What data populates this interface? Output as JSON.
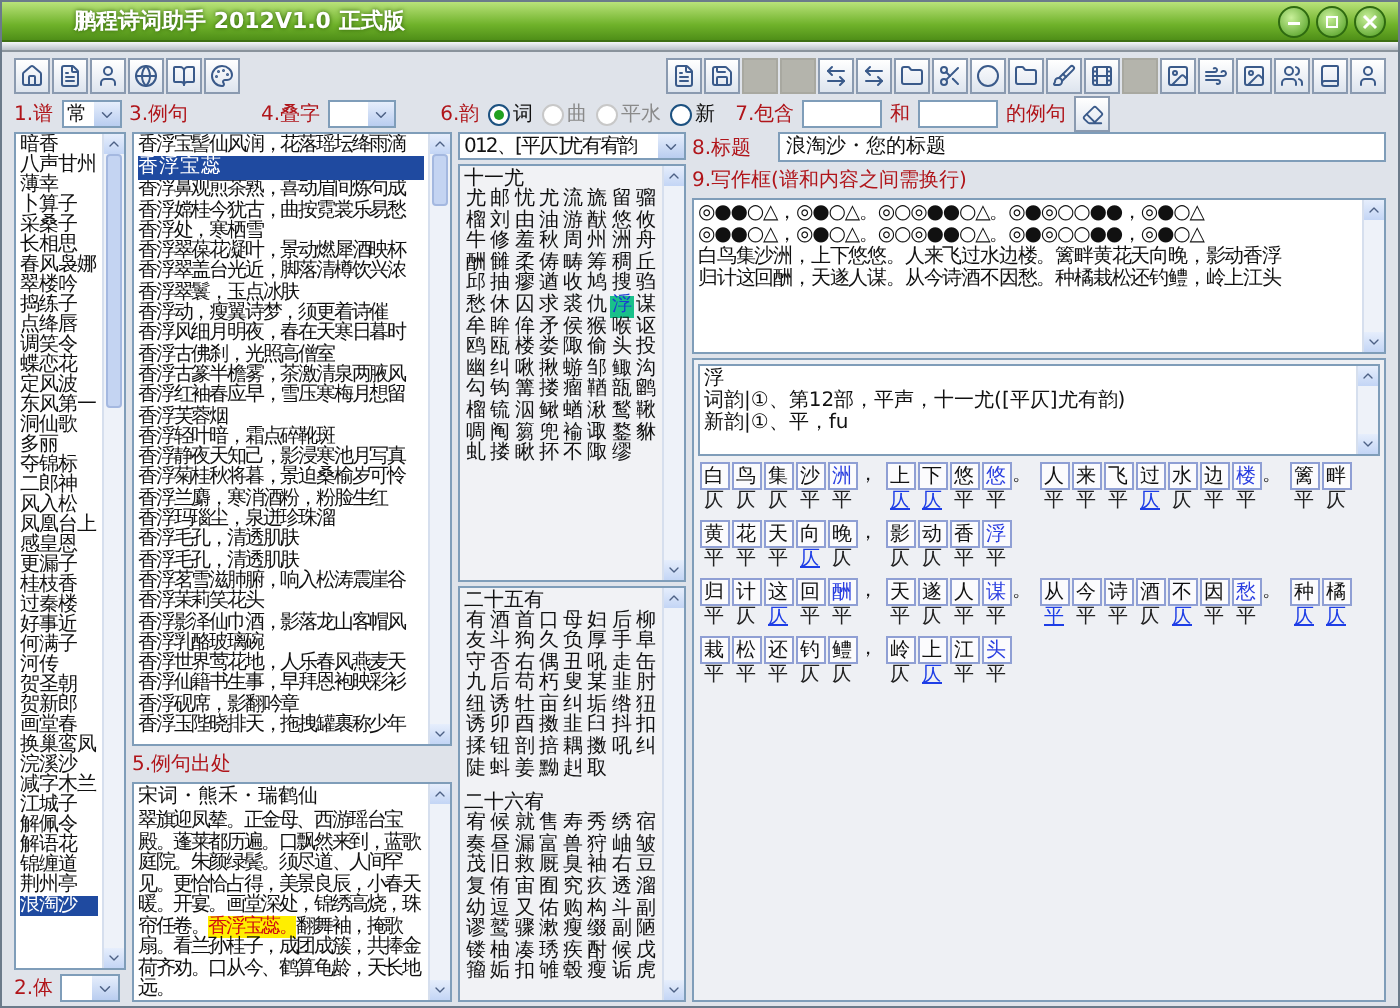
{
  "window": {
    "title": "鹏程诗词助手 2012V1.0 正式版"
  },
  "fields": {
    "pu_label": "1.谱",
    "pu_value": "常",
    "ti_label": "2.体",
    "liju_label": "3.例句",
    "diezi_label": "4.叠字",
    "chuchu_label": "5.例句出处",
    "yun_label": "6.韵",
    "baohan_label": "7.包含",
    "he_label": "和",
    "deliju_label": "的例句",
    "title_label": "8.标题",
    "title_value": "浪淘沙・您的标题",
    "write_label": "9.写作框(谱和内容之间需换行)"
  },
  "rhyme_options": [
    {
      "label": "词",
      "selected": true,
      "disabled": false
    },
    {
      "label": "曲",
      "selected": false,
      "disabled": true
    },
    {
      "label": "平水",
      "selected": false,
      "disabled": true
    },
    {
      "label": "新",
      "selected": false,
      "disabled": false
    }
  ],
  "cipai": [
    {
      "label": "暗香",
      "selected": false
    },
    {
      "label": "八声甘州",
      "selected": false
    },
    {
      "label": "薄幸",
      "selected": false
    },
    {
      "label": "卜算子",
      "selected": false
    },
    {
      "label": "采桑子",
      "selected": false
    },
    {
      "label": "长相思",
      "selected": false
    },
    {
      "label": "春风袅娜",
      "selected": false
    },
    {
      "label": "翠楼吟",
      "selected": false
    },
    {
      "label": "捣练子",
      "selected": false
    },
    {
      "label": "点绛唇",
      "selected": false
    },
    {
      "label": "调笑令",
      "selected": false
    },
    {
      "label": "蝶恋花",
      "selected": false
    },
    {
      "label": "定风波",
      "selected": false
    },
    {
      "label": "东风第一",
      "selected": false
    },
    {
      "label": "洞仙歌",
      "selected": false
    },
    {
      "label": "多丽",
      "selected": false
    },
    {
      "label": "夺锦标",
      "selected": false
    },
    {
      "label": "二郎神",
      "selected": false
    },
    {
      "label": "风入松",
      "selected": false
    },
    {
      "label": "凤凰台上",
      "selected": false
    },
    {
      "label": "感皇恩",
      "selected": false
    },
    {
      "label": "更漏子",
      "selected": false
    },
    {
      "label": "桂枝香",
      "selected": false
    },
    {
      "label": "过秦楼",
      "selected": false
    },
    {
      "label": "好事近",
      "selected": false
    },
    {
      "label": "何满子",
      "selected": false
    },
    {
      "label": "河传",
      "selected": false
    },
    {
      "label": "贺圣朝",
      "selected": false
    },
    {
      "label": "贺新郎",
      "selected": false
    },
    {
      "label": "画堂春",
      "selected": false
    },
    {
      "label": "换巢鸾凤",
      "selected": false
    },
    {
      "label": "浣溪沙",
      "selected": false
    },
    {
      "label": "减字木兰",
      "selected": false
    },
    {
      "label": "江城子",
      "selected": false
    },
    {
      "label": "解佩令",
      "selected": false
    },
    {
      "label": "解语花",
      "selected": false
    },
    {
      "label": "锦缠道",
      "selected": false
    },
    {
      "label": "荆州亭",
      "selected": false
    },
    {
      "label": "浪淘沙",
      "selected": true
    }
  ],
  "examples": [
    {
      "text": "香浮宝髻仙风润，花落瑶坛绛雨滴",
      "selected": false
    },
    {
      "text": "香浮宝蕊",
      "selected": true
    },
    {
      "text": "香浮鼻观煎茶熟，喜动眉间炼句成",
      "selected": false
    },
    {
      "text": "香浮嫦桂今犹古，曲按霓裳乐易愁",
      "selected": false
    },
    {
      "text": "香浮处，寒栖雪",
      "selected": false
    },
    {
      "text": "香浮翠葆花凝叶，景动燃犀酒映杯",
      "selected": false
    },
    {
      "text": "香浮翠盖台光近，脚落清樽饮兴浓",
      "selected": false
    },
    {
      "text": "香浮翠鬟，玉点冰肤",
      "selected": false
    },
    {
      "text": "香浮动，瘦翼诗梦，须更着诗催",
      "selected": false
    },
    {
      "text": "香浮风细月明夜，春在天寒日暮时",
      "selected": false
    },
    {
      "text": "香浮古佛刹，光照高僧室",
      "selected": false
    },
    {
      "text": "香浮古篆半檐雾，茶激清泉两腋风",
      "selected": false
    },
    {
      "text": "香浮红袖春应早，雪压寒梅月想留",
      "selected": false
    },
    {
      "text": "香浮芙蓉烟",
      "selected": false
    },
    {
      "text": "香浮轻叶暗，霜点碎靴斑",
      "selected": false
    },
    {
      "text": "香浮静夜天知己，影浸寒池月写真",
      "selected": false
    },
    {
      "text": "香浮菊桂秋将暮，景迫桑榆岁可怜",
      "selected": false
    },
    {
      "text": "香浮兰麝，寒消酒粉，粉脸生红",
      "selected": false
    },
    {
      "text": "香浮玛瑙尘，泉迸珍珠溜",
      "selected": false
    },
    {
      "text": "香浮毛孔，清透肌肤",
      "selected": false
    },
    {
      "text": "香浮毛孔，清透肌肤",
      "selected": false
    },
    {
      "text": "香浮茗雪滋肺腑，响入松涛震崖谷",
      "selected": false
    },
    {
      "text": "香浮茉莉笑花头",
      "selected": false
    },
    {
      "text": "香浮影泽仙巾酒，影落龙山客帽风",
      "selected": false
    },
    {
      "text": "香浮乳酪玻璃碗",
      "selected": false
    },
    {
      "text": "香浮世界莺花地，人乐春风燕麦天",
      "selected": false
    },
    {
      "text": "香浮仙籍书生事，早拜恩袍映彩衫",
      "selected": false
    },
    {
      "text": "香浮砚席，影翻吟章",
      "selected": false
    },
    {
      "text": "香浮玉陛晓排天，拖拽罐裹称少年",
      "selected": false
    }
  ],
  "source": {
    "heading": "宋词・熊禾・瑞鹤仙",
    "text": "翠旗迎凤辇。正金母、西游瑶台宝殿。蓬莱都历遍。口飘然来到，蓝歌庭院。朱颜绿鬓。须尽道、人间罕见。更恰恰占得，美景良辰，小春天暖。开宴。画堂深处，锦绣高烧，珠帘任卷。**香浮宝蕊。**翻舞袖，掩歌扇。看兰孙桂子，成团成簇，共捧金荷齐劝。口从今、鹤算龟龄，天长地远。"
  },
  "rhyme_select": "012、[平仄]尤有宥韵",
  "rhyme_groups": [
    {
      "heading": "十一尤",
      "rows": [
        "尤邮忧尤流旒留骝",
        "榴刘由油游猷悠攸",
        "牛修羞秋周州洲舟",
        "酬雠柔俦畴筹稠丘",
        "邱抽瘳遒收鸠搜驺",
        {
          "before": "愁休囚求裘仇",
          "highlighted": "浮",
          "after": "谋"
        },
        "牟眸侔矛侯猴喉讴",
        "鸥瓯楼娄陬偷头投",
        "幽纠啾揪蝣邹鲰沟",
        "勾钩篝搂瘤鞧瓿鹠",
        "榴锍泅鳅蝤湫鹙鞦",
        "啁阄篘兜褕诹鍪貅",
        "虬搂瞅抔不陬缪"
      ]
    },
    {
      "heading": "二十五有",
      "rows": [
        "有酒首口母妇后柳",
        "友斗狗久负厚手阜",
        "守否右偶丑吼走缶",
        "九后苟朽叟某韭肘",
        "纽诱牡亩纠垢绺狃",
        "诱卯酉擞韭臼抖扣",
        "揉钮剖掊耦擞吼纠",
        "陡蚪姜黝赳取"
      ]
    },
    {
      "heading": "二十六宥",
      "rows": [
        "宥候就售寿秀绣宿",
        "奏昼漏富兽狩岫皱",
        "茂旧救厩臭袖右豆",
        "复侑宙囿究疚透溜",
        "幼逗又佑购构斗副",
        "谬鹫骤漱瘦缀副陋",
        "镂柚凑琇疾酎候戊",
        "籀姤扣雊毂瘦诟虎"
      ]
    }
  ],
  "writing_lines": [
    "◎●●○△，◎●○△。◎○◎●●○△。◎●◎○○●●，◎●○△",
    "◎●●○△，◎●○△。◎○◎●●○△。◎●◎○○●●，◎●○△",
    "白鸟集沙洲，上下悠悠。人来飞过水边楼。篱畔黄花天向晚，影动香浮",
    "归计这回酬，天遂人谋。从今诗酒不因愁。种橘栽松还钓鳢，岭上江头"
  ],
  "char_info": [
    "浮",
    "词韵|①、第12部，平声，十一尤([平仄]尤有韵)",
    "新韵|①、平，fu"
  ],
  "analysis_rows": [
    [
      {
        "punct": "，",
        "cells": [
          {
            "char": "白",
            "tone": "仄",
            "rhyme": false,
            "mismatch": false
          },
          {
            "char": "鸟",
            "tone": "仄",
            "rhyme": false,
            "mismatch": false
          },
          {
            "char": "集",
            "tone": "仄",
            "rhyme": false,
            "mismatch": false
          },
          {
            "char": "沙",
            "tone": "平",
            "rhyme": false,
            "mismatch": false
          },
          {
            "char": "洲",
            "tone": "平",
            "rhyme": true,
            "mismatch": false
          }
        ]
      },
      {
        "punct": "。",
        "cells": [
          {
            "char": "上",
            "tone": "仄",
            "rhyme": false,
            "mismatch": true
          },
          {
            "char": "下",
            "tone": "仄",
            "rhyme": false,
            "mismatch": true
          },
          {
            "char": "悠",
            "tone": "平",
            "rhyme": false,
            "mismatch": false
          },
          {
            "char": "悠",
            "tone": "平",
            "rhyme": true,
            "mismatch": false
          }
        ]
      },
      {
        "punct": "。",
        "cells": [
          {
            "char": "人",
            "tone": "平",
            "rhyme": false,
            "mismatch": false
          },
          {
            "char": "来",
            "tone": "平",
            "rhyme": false,
            "mismatch": false
          },
          {
            "char": "飞",
            "tone": "平",
            "rhyme": false,
            "mismatch": false
          },
          {
            "char": "过",
            "tone": "仄",
            "rhyme": false,
            "mismatch": true
          },
          {
            "char": "水",
            "tone": "仄",
            "rhyme": false,
            "mismatch": false
          },
          {
            "char": "边",
            "tone": "平",
            "rhyme": false,
            "mismatch": false
          },
          {
            "char": "楼",
            "tone": "平",
            "rhyme": true,
            "mismatch": false
          }
        ]
      },
      {
        "cells": [
          {
            "char": "篱",
            "tone": "平",
            "rhyme": false,
            "mismatch": false
          },
          {
            "char": "畔",
            "tone": "仄",
            "rhyme": false,
            "mismatch": false
          }
        ]
      }
    ],
    [
      {
        "punct": "，",
        "cells": [
          {
            "char": "黄",
            "tone": "平",
            "rhyme": false,
            "mismatch": false
          },
          {
            "char": "花",
            "tone": "平",
            "rhyme": false,
            "mismatch": false
          },
          {
            "char": "天",
            "tone": "平",
            "rhyme": false,
            "mismatch": false
          },
          {
            "char": "向",
            "tone": "仄",
            "rhyme": false,
            "mismatch": true
          },
          {
            "char": "晚",
            "tone": "仄",
            "rhyme": false,
            "mismatch": false
          }
        ]
      },
      {
        "cells": [
          {
            "char": "影",
            "tone": "仄",
            "rhyme": false,
            "mismatch": false
          },
          {
            "char": "动",
            "tone": "仄",
            "rhyme": false,
            "mismatch": false
          },
          {
            "char": "香",
            "tone": "平",
            "rhyme": false,
            "mismatch": false
          },
          {
            "char": "浮",
            "tone": "平",
            "rhyme": true,
            "mismatch": false
          }
        ]
      }
    ],
    [
      {
        "punct": "，",
        "cells": [
          {
            "char": "归",
            "tone": "平",
            "rhyme": false,
            "mismatch": false
          },
          {
            "char": "计",
            "tone": "仄",
            "rhyme": false,
            "mismatch": false
          },
          {
            "char": "这",
            "tone": "仄",
            "rhyme": false,
            "mismatch": true
          },
          {
            "char": "回",
            "tone": "平",
            "rhyme": false,
            "mismatch": false
          },
          {
            "char": "酬",
            "tone": "平",
            "rhyme": true,
            "mismatch": false
          }
        ]
      },
      {
        "punct": "。",
        "cells": [
          {
            "char": "天",
            "tone": "平",
            "rhyme": false,
            "mismatch": false
          },
          {
            "char": "遂",
            "tone": "仄",
            "rhyme": false,
            "mismatch": false
          },
          {
            "char": "人",
            "tone": "平",
            "rhyme": false,
            "mismatch": false
          },
          {
            "char": "谋",
            "tone": "平",
            "rhyme": true,
            "mismatch": false
          }
        ]
      },
      {
        "punct": "。",
        "cells": [
          {
            "char": "从",
            "tone": "平",
            "rhyme": false,
            "mismatch": true
          },
          {
            "char": "今",
            "tone": "平",
            "rhyme": false,
            "mismatch": false
          },
          {
            "char": "诗",
            "tone": "平",
            "rhyme": false,
            "mismatch": false
          },
          {
            "char": "酒",
            "tone": "仄",
            "rhyme": false,
            "mismatch": false
          },
          {
            "char": "不",
            "tone": "仄",
            "rhyme": false,
            "mismatch": true
          },
          {
            "char": "因",
            "tone": "平",
            "rhyme": false,
            "mismatch": false
          },
          {
            "char": "愁",
            "tone": "平",
            "rhyme": true,
            "mismatch": false
          }
        ]
      },
      {
        "cells": [
          {
            "char": "种",
            "tone": "仄",
            "rhyme": false,
            "mismatch": true
          },
          {
            "char": "橘",
            "tone": "仄",
            "rhyme": false,
            "mismatch": true
          }
        ]
      }
    ],
    [
      {
        "punct": "，",
        "cells": [
          {
            "char": "栽",
            "tone": "平",
            "rhyme": false,
            "mismatch": false
          },
          {
            "char": "松",
            "tone": "平",
            "rhyme": false,
            "mismatch": false
          },
          {
            "char": "还",
            "tone": "平",
            "rhyme": false,
            "mismatch": false
          },
          {
            "char": "钓",
            "tone": "仄",
            "rhyme": false,
            "mismatch": false
          },
          {
            "char": "鳢",
            "tone": "仄",
            "rhyme": false,
            "mismatch": false
          }
        ]
      },
      {
        "cells": [
          {
            "char": "岭",
            "tone": "仄",
            "rhyme": false,
            "mismatch": false
          },
          {
            "char": "上",
            "tone": "仄",
            "rhyme": false,
            "mismatch": true
          },
          {
            "char": "江",
            "tone": "平",
            "rhyme": false,
            "mismatch": false
          },
          {
            "char": "头",
            "tone": "平",
            "rhyme": true,
            "mismatch": false
          }
        ]
      }
    ]
  ]
}
